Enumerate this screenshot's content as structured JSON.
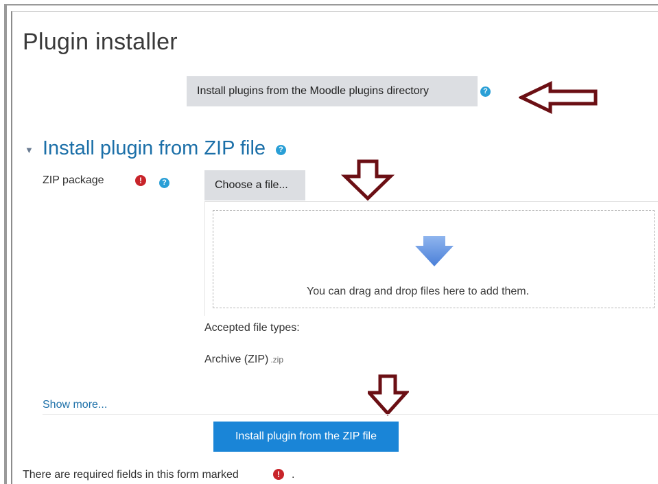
{
  "page": {
    "title": "Plugin installer"
  },
  "directory": {
    "button_label": "Install plugins from the Moodle plugins directory",
    "help_glyph": "?"
  },
  "zip_section": {
    "caret_glyph": "▼",
    "title": "Install plugin from ZIP file",
    "help_glyph": "?",
    "field_label": "ZIP package",
    "required_glyph": "!",
    "choose_button_label": "Choose a file...",
    "drop_text": "You can drag and drop files here to add them.",
    "accepted_label": "Accepted file types:",
    "filetype_name": "Archive (ZIP)",
    "filetype_ext": ".zip",
    "show_more_label": "Show more..."
  },
  "actions": {
    "install_button_label": "Install plugin from the ZIP file"
  },
  "footer": {
    "required_note": "There are required fields in this form marked",
    "required_glyph": "!",
    "trailing_dot": "."
  },
  "colors": {
    "link_blue": "#1b6fa8",
    "primary_button": "#1a85d7",
    "help_icon": "#2a9fd6",
    "required_icon": "#c8242a",
    "annotation_arrow": "#6b0f14",
    "drop_arrow": "#5b8fe0"
  },
  "icons": {
    "help": "help-icon",
    "required": "required-icon",
    "section_toggle": "caret-down-icon",
    "drop_arrow": "download-arrow-icon",
    "annotation": "annotation-arrow-icon"
  }
}
